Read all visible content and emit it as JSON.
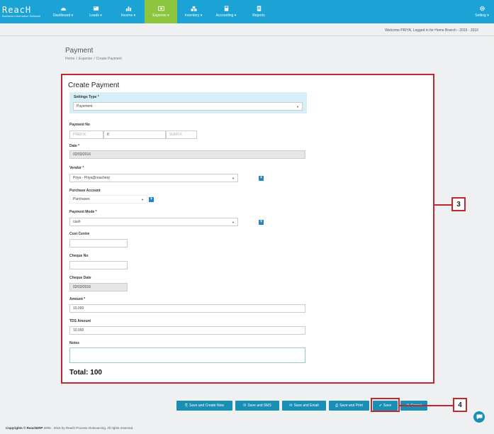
{
  "brand": {
    "logo": "ReacH",
    "tagline": "Business Information Software"
  },
  "nav": [
    {
      "id": "dashboard",
      "label": "Dashboard ▾",
      "icon": "dashboard-icon",
      "active": false
    },
    {
      "id": "leads",
      "label": "Leads ▾",
      "icon": "leads-icon",
      "active": false
    },
    {
      "id": "income",
      "label": "Income ▾",
      "icon": "chart-icon",
      "active": false
    },
    {
      "id": "expense",
      "label": "Expense ▾",
      "icon": "money-icon",
      "active": true
    },
    {
      "id": "inventory",
      "label": "Inventory ▾",
      "icon": "cubes-icon",
      "active": false
    },
    {
      "id": "accounting",
      "label": "Accounting ▾",
      "icon": "calculator-icon",
      "active": false
    },
    {
      "id": "reports",
      "label": "Reports",
      "icon": "report-icon",
      "active": false
    }
  ],
  "setting": {
    "label": "Setting ▾",
    "icon": "gear-icon"
  },
  "welcome": "Welcome PRIYA, Logged in for Home Branch - 2015 - 2016",
  "page": {
    "title": "Payment",
    "breadcrumb": [
      "Home",
      "/",
      "Expense",
      "/",
      "Create Payment"
    ]
  },
  "form": {
    "title": "Create Payment",
    "settings_type": {
      "label": "Settings Type *",
      "value": "Payement"
    },
    "payment_no": {
      "label": "Payment No",
      "prefix_placeholder": "PREFIX",
      "number": "8",
      "suffix_placeholder": "SUFFIX"
    },
    "date": {
      "label": "Date *",
      "value": "02/03/2016"
    },
    "vendor": {
      "label": "Vendor *",
      "value": "Priya - Priya@reacherp"
    },
    "purchase_account": {
      "label": "Purchase Account",
      "value": "Purchases"
    },
    "payment_mode": {
      "label": "Payment Mode *",
      "value": "cash"
    },
    "cost_centre": {
      "label": "Cost Centre",
      "value": ""
    },
    "cheque_no": {
      "label": "Cheque No",
      "value": ""
    },
    "cheque_date": {
      "label": "Cheque Date",
      "value": "02/03/2016"
    },
    "amount": {
      "label": "Amount *",
      "value": "10.000"
    },
    "tds_amount": {
      "label": "TDS Amount",
      "value": "10.000"
    },
    "notes": {
      "label": "Notes",
      "value": ""
    },
    "total": "Total: 100"
  },
  "callouts": {
    "form": "3",
    "save": "4"
  },
  "actions": [
    {
      "id": "save-create-new",
      "label": "Save and Create New",
      "icon": "⎘"
    },
    {
      "id": "save-sms",
      "label": "Save and SMS",
      "icon": "✉"
    },
    {
      "id": "save-email",
      "label": "Save and Email",
      "icon": "✉"
    },
    {
      "id": "save-print",
      "label": "Save and Print",
      "icon": "⎙"
    },
    {
      "id": "save",
      "label": "Save",
      "icon": "✔"
    },
    {
      "id": "cancel",
      "label": "Cancel",
      "icon": "⊘"
    }
  ],
  "footer": {
    "brand": "Copyrights © ReachERP",
    "text": "2005 - 2016 by Reach Process Outsourcing. All rights reserved."
  },
  "colors": {
    "nav": "#1aa3d4",
    "active": "#8cc63f",
    "button": "#1a8fb5",
    "highlight": "#c0282e"
  }
}
